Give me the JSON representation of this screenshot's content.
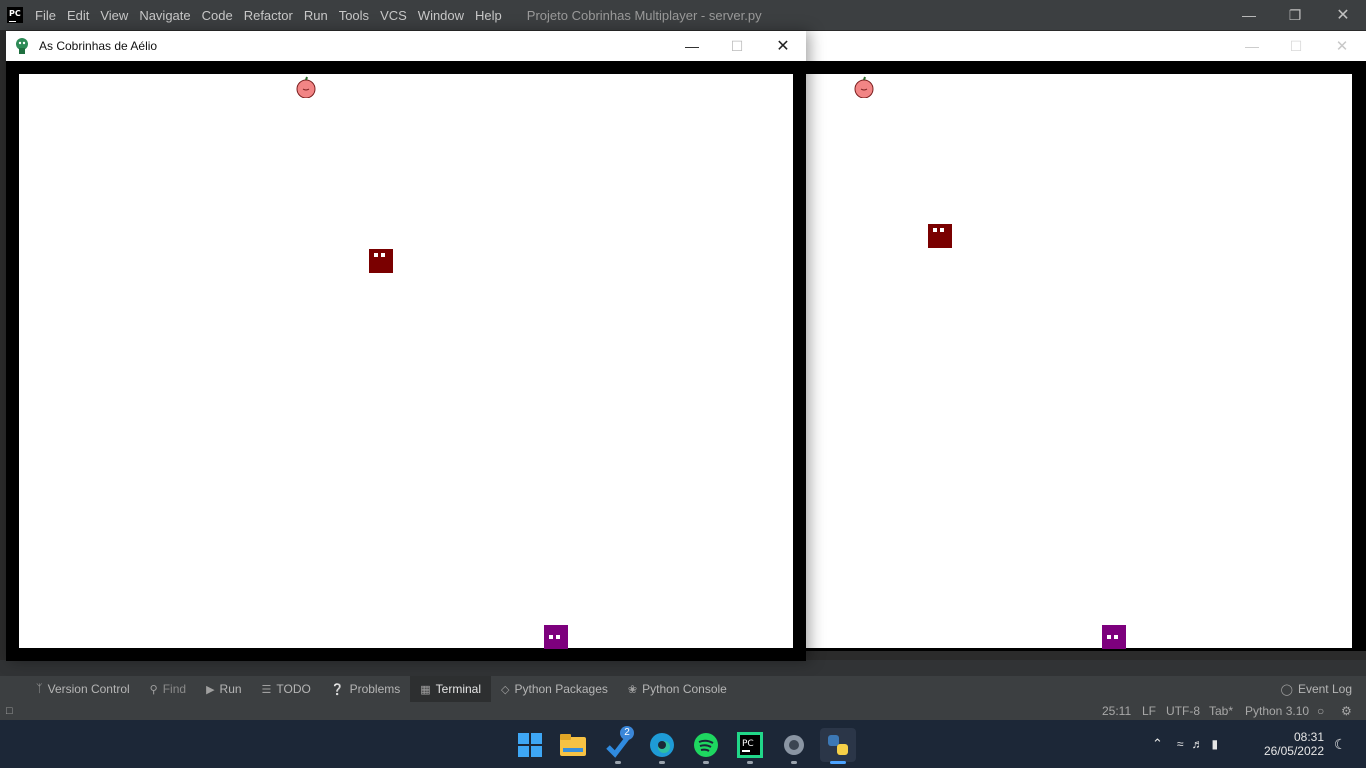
{
  "ide": {
    "menu": [
      "File",
      "Edit",
      "View",
      "Navigate",
      "Code",
      "Refactor",
      "Run",
      "Tools",
      "VCS",
      "Window",
      "Help"
    ],
    "title": "Projeto Cobrinhas Multiplayer - server.py",
    "logo_text": "PC"
  },
  "game_window": {
    "title": "As Cobrinhas de Aélio",
    "colors": {
      "apple": "#f28585",
      "snake_red": "#7a0000",
      "snake_purple": "#7d007d",
      "frame": "#000000"
    }
  },
  "toolbar": {
    "items": [
      {
        "label": "Version Control",
        "icon": "branch-icon"
      },
      {
        "label": "Find",
        "icon": "search-icon"
      },
      {
        "label": "Run",
        "icon": "play-icon"
      },
      {
        "label": "TODO",
        "icon": "list-icon"
      },
      {
        "label": "Problems",
        "icon": "info-icon"
      },
      {
        "label": "Terminal",
        "icon": "terminal-icon",
        "active": true
      },
      {
        "label": "Python Packages",
        "icon": "layers-icon"
      },
      {
        "label": "Python Console",
        "icon": "python-icon"
      }
    ],
    "event_log": "Event Log"
  },
  "status": {
    "position": "25:11",
    "line_ending": "LF",
    "encoding": "UTF-8",
    "indent": "Tab*",
    "interpreter": "Python 3.10"
  },
  "taskbar": {
    "badge_count": "2",
    "time": "08:31",
    "date": "26/05/2022"
  }
}
